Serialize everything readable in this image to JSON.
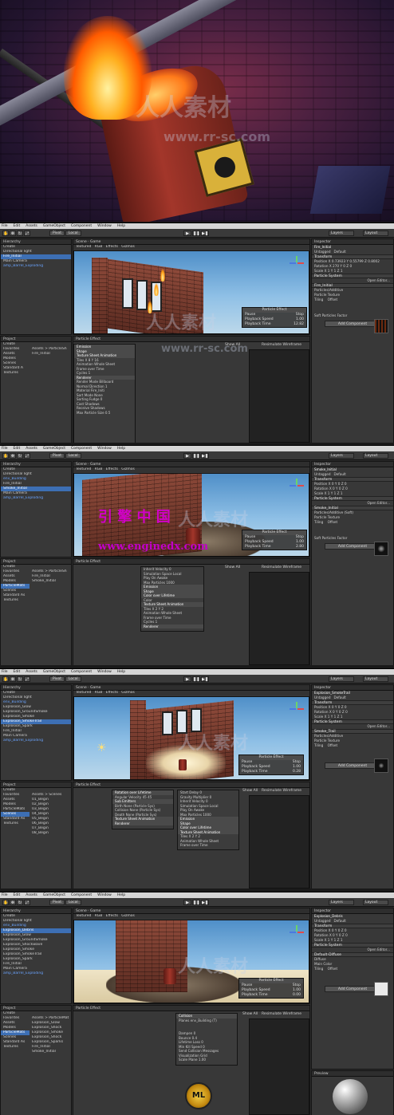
{
  "hero": {
    "watermark_cn": "人人素材",
    "watermark_url": "www.rr-sc.com"
  },
  "menu": [
    "File",
    "Edit",
    "Assets",
    "GameObject",
    "Component",
    "Window",
    "Help"
  ],
  "toolbar": {
    "pivot": "Pivot",
    "local": "Local",
    "layers": "Layers",
    "layout": "Layout",
    "play": "▶",
    "pause": "❚❚",
    "step": "▶❚"
  },
  "tabs": {
    "hierarchy": "Hierarchy",
    "scene": "Scene",
    "game": "Game",
    "project": "Project",
    "inspector": "Inspector",
    "particle_effect": "Particle Effect",
    "create": "Create",
    "all": "All",
    "textured": "Textured",
    "rgb": "RGB",
    "effects": "Effects",
    "gizmos": "Gizmos",
    "show_all": "Show All",
    "resimulate": "Resimulate",
    "wireframe": "Wireframe"
  },
  "panels": [
    {
      "hierarchy": [
        "Directional light",
        "Fire_Initial",
        "Main Camera",
        "amp_Barrel_Exploding"
      ],
      "hier_sel": 1,
      "project_tree": [
        "Favorites",
        "Assets",
        "Models",
        "Scenes",
        "Standard A",
        "Textures"
      ],
      "project_files": [
        "Fire_Initial"
      ],
      "project_path": "Assets > ParticleSh",
      "inspector": {
        "name": "Fire_Initial",
        "tag": "Untagged",
        "layer": "Default",
        "comps": [
          "Transform",
          "Particle System"
        ],
        "rows": [
          "Position  X 0.73923  Y 0.55799  Z 0.8002",
          "Rotation  X 270  Y 0  Z 0",
          "Scale  X 1  Y 1  Z 1"
        ],
        "open_editor": "Open Editor...",
        "material": "Fire_Initial",
        "shader": "Particles/Additive",
        "texture": "Particle Texture",
        "tiling": "Tiling",
        "offset": "Offset",
        "soft": "Soft Particles Factor",
        "add": "Add Component"
      },
      "pe": {
        "title": "Particle Effect",
        "pause": "Pause",
        "stop": "Stop",
        "speed_l": "Playback Speed",
        "speed_v": "1.00",
        "time_l": "Playback Time",
        "time_v": "12.82"
      },
      "modules": [
        "Emission",
        "Shape",
        "Texture Sheet Animation",
        "Tiles   X 8   Y 16",
        "Animation   Whole Sheet",
        "Frame over Time",
        "Cycles   1",
        "Renderer",
        "Render Mode   Billboard",
        "Normal Direction  1",
        "Material   Fire_Initi",
        "Sort Mode   None",
        "Sorting Fudge   0",
        "Cast Shadows",
        "Receive Shadows",
        "Max Particle Size  0.5"
      ]
    },
    {
      "hierarchy": [
        "Directional light",
        "env_Building",
        "Fire_Initial",
        "Smoke_Initial",
        "Main Camera",
        "amp_Barrel_Exploding"
      ],
      "hier_sel": 3,
      "project_tree": [
        "Favorites",
        "Assets",
        "Models",
        "ParticleMats",
        "Scenes",
        "Standard As",
        "Textures"
      ],
      "project_files": [
        "Fire_Initial",
        "Smoke_Initial"
      ],
      "project_path": "Assets > ParticleSh",
      "inspector": {
        "name": "Smoke_Initial",
        "tag": "Untagged",
        "layer": "Default",
        "comps": [
          "Transform",
          "Particle System"
        ],
        "rows": [
          "Position  X 0  Y 0  Z 0",
          "Rotation  X 0  Y 0  Z 0",
          "Scale  X 1  Y 1  Z 1"
        ],
        "open_editor": "Open Editor...",
        "material": "Smoke_Initial",
        "shader": "Particles/Additive (Soft)",
        "texture": "Particle Texture",
        "tiling": "Tiling",
        "offset": "Offset",
        "soft": "Soft Particles Factor",
        "add": "Add Component"
      },
      "pe": {
        "title": "Particle Effect",
        "pause": "Pause",
        "stop": "Stop",
        "speed_l": "Playback Speed",
        "speed_v": "1.00",
        "time_l": "Playback Time",
        "time_v": "2.80"
      },
      "modules": [
        "Inherit Velocity   0",
        "Simulation Space   Local",
        "Play On Awake",
        "Max Particles   1000",
        "Emission",
        "Shape",
        "Color over Lifetime",
        "Color",
        "Texture Sheet Animation",
        "Tiles   X 2   Y 2",
        "Animation   Whole Sheet",
        "Frame over Time",
        "Cycles   1",
        "Renderer"
      ],
      "cn_text": "引  擎  中  国",
      "url_text": "www.enginedx.com"
    },
    {
      "hierarchy": [
        "Directional light",
        "env_Building",
        "Explosion_Glow",
        "Explosion_GroundSmoke",
        "Explosion_Smoke",
        "Explosion_SmokeTrail",
        "Explosion_Spark",
        "Fire_Initial",
        "Main Camera",
        "amp_Barrel_Exploding"
      ],
      "hier_sel": 5,
      "project_tree": [
        "Favorites",
        "Assets",
        "Models",
        "ParticleMats",
        "Scenes",
        "Standard As",
        "Textures"
      ],
      "project_files": [
        "01_Begin",
        "02_Begin",
        "03_Begin",
        "04_Begin",
        "05_Begin",
        "06_Begin",
        "07_Begin",
        "08_Begin"
      ],
      "project_path": "Assets > Scenes",
      "inspector": {
        "name": "Explosion_SmokeTrail",
        "tag": "Untagged",
        "layer": "Default",
        "comps": [
          "Transform",
          "Particle System"
        ],
        "rows": [
          "Position  X 0  Y 0  Z 0",
          "Rotation  X 0  Y 0  Z 0",
          "Scale  X 1  Y 1  Z 1"
        ],
        "open_editor": "Open Editor...",
        "material": "Smoke_Trail",
        "shader": "Particles/Additive",
        "texture": "Particle Texture",
        "tiling": "Tiling",
        "offset": "Offset",
        "soft": "",
        "add": "Add Component"
      },
      "pe": {
        "title": "Particle Effect",
        "pause": "Pause",
        "stop": "Stop",
        "speed_l": "Playback Speed",
        "speed_v": "1.00",
        "time_l": "Playback Time",
        "time_v": "0.28"
      },
      "modules": [
        "Rotation over Lifetime",
        "Angular Velocity  45  45",
        "Sub Emitters",
        "Birth   None (Particle Sys)",
        "Collision  None (Particle Sys)",
        "Death   None (Particle Sys)",
        "Texture Sheet Animation",
        "Renderer"
      ],
      "modules2": [
        "Start Delay   0",
        "Gravity Multiplier  0",
        "Inherit Velocity   0",
        "Simulation Space   Local",
        "Play On Awake",
        "Max Particles   1000",
        "Emission",
        "Shape",
        "Color over Lifetime",
        "Texture Sheet Animation",
        "Tiles   X 2   Y 2",
        "Animation   Whole Sheet",
        "Frame over Time"
      ]
    },
    {
      "hierarchy": [
        "Directional light",
        "env_Building",
        "Explosion_Debris",
        "Explosion_Glow",
        "Explosion_GroundSmoke",
        "Explosion_Shockwave",
        "Explosion_Smoke",
        "Explosion_SmokeTrail",
        "Explosion_Spark",
        "Fire_Initial",
        "Main Camera",
        "amp_Barrel_Exploding"
      ],
      "hier_sel": 2,
      "project_tree": [
        "Favorites",
        "Assets",
        "Models",
        "ParticleMats",
        "Scenes",
        "Standard As",
        "Textures"
      ],
      "project_files": [
        "Explosion_Glow",
        "Explosion_Shock",
        "Explosion_Smoke",
        "Explosion_Shock",
        "Explosion_Sparks",
        "Fire_Initial",
        "Smoke_Initial"
      ],
      "project_path": "Assets > ParticleMat",
      "inspector": {
        "name": "Explosion_Debris",
        "tag": "Untagged",
        "layer": "Default",
        "comps": [
          "Transform",
          "Particle System"
        ],
        "rows": [
          "Position  X 0  Y 0  Z 0",
          "Rotation  X 0  Y 0  Z 0",
          "Scale  X 1  Y 1  Z 1"
        ],
        "open_editor": "Open Editor...",
        "material": "Default-Diffuse",
        "shader": "Diffuse",
        "texture": "Main Color",
        "tiling": "Tiling",
        "offset": "Offset",
        "soft": "",
        "add": "Add Component"
      },
      "pe": {
        "title": "Particle Effect",
        "pause": "Pause",
        "stop": "Stop",
        "speed_l": "Playback Speed",
        "speed_v": "1.00",
        "time_l": "Playback Time",
        "time_v": "0.00"
      },
      "modules": [
        "Collision",
        "Planes   env_Building (T)",
        "",
        "",
        "Dampen   0",
        "Bounce   0.4",
        "Lifetime Loss  0",
        "Min Kill Speed  0",
        "Send Collision Messages",
        "Visualization  Grid",
        "Scale Plane   1.00"
      ],
      "preview": "Preview"
    }
  ],
  "logo_text": "ML"
}
